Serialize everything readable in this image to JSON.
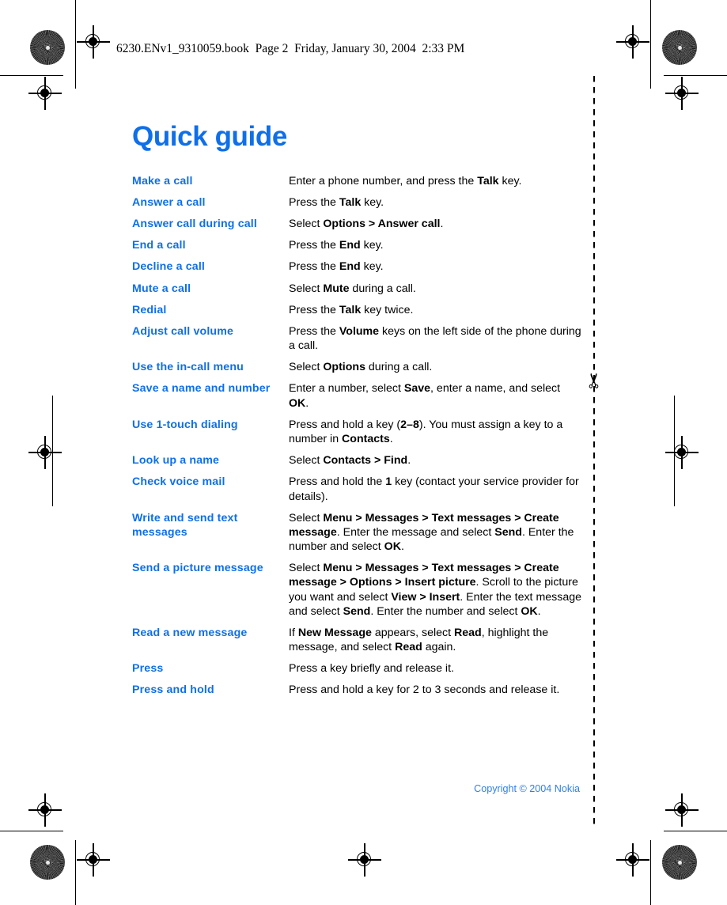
{
  "header": {
    "file_line": "6230.ENv1_9310059.book  Page 2  Friday, January 30, 2004  2:33 PM"
  },
  "page": {
    "title": "Quick guide",
    "footer_copyright": "Copyright © 2004 Nokia"
  },
  "marks": {
    "scissors_glyph": "✂"
  },
  "guide_rows": [
    {
      "term": "Make a call",
      "desc_html": "Enter a phone number, and press the <b>Talk</b> key."
    },
    {
      "term": "Answer a call",
      "desc_html": "Press the <b>Talk</b> key."
    },
    {
      "term": "Answer call during call",
      "desc_html": "Select <b>Options &gt; Answer call</b>."
    },
    {
      "term": "End a call",
      "desc_html": "Press the <b>End</b> key."
    },
    {
      "term": "Decline a call",
      "desc_html": "Press the <b>End</b> key."
    },
    {
      "term": "Mute a call",
      "desc_html": "Select <b>Mute</b> during a call."
    },
    {
      "term": "Redial",
      "desc_html": "Press the <b>Talk</b> key twice."
    },
    {
      "term": "Adjust call volume",
      "desc_html": "Press the <b>Volume</b> keys on the left side of the phone during a call."
    },
    {
      "term": "Use the in-call menu",
      "desc_html": "Select <b>Options</b> during a call."
    },
    {
      "term": "Save a name and number",
      "desc_html": "Enter a number, select <b>Save</b>, enter a name, and select <b>OK</b>."
    },
    {
      "term": "Use 1-touch dialing",
      "desc_html": "Press and hold a key (<b>2–8</b>). You must assign a key to a number in <b>Contacts</b>."
    },
    {
      "term": "Look up a name",
      "desc_html": "Select <b>Contacts &gt; Find</b>."
    },
    {
      "term": "Check voice mail",
      "desc_html": "Press and hold the <b>1</b> key (contact your service provider for details)."
    },
    {
      "term": "Write and send text messages",
      "desc_html": "Select <b>Menu &gt; Messages &gt; Text messages &gt; Create message</b>. Enter the message and select <b>Send</b>. Enter the number and select <b>OK</b>."
    },
    {
      "term": "Send a picture message",
      "desc_html": "Select <b>Menu &gt; Messages &gt; Text messages &gt; Create message &gt; Options &gt; Insert picture</b>. Scroll to the picture you want and select <b>View &gt; Insert</b>. Enter the text message and select <b>Send</b>. Enter the number and select <b>OK</b>."
    },
    {
      "term": "Read a new message",
      "desc_html": "If <b>New Message</b> appears, select <b>Read</b>, highlight the message, and select <b>Read</b> again."
    },
    {
      "term": "Press",
      "desc_html": "Press a key briefly and release it."
    },
    {
      "term": "Press and hold",
      "desc_html": "Press and hold a key for 2 to 3 seconds and release it."
    }
  ],
  "colors": {
    "accent_blue": "#0f6fe8",
    "text_black": "#000000",
    "footer_blue": "#2f7fe8"
  }
}
